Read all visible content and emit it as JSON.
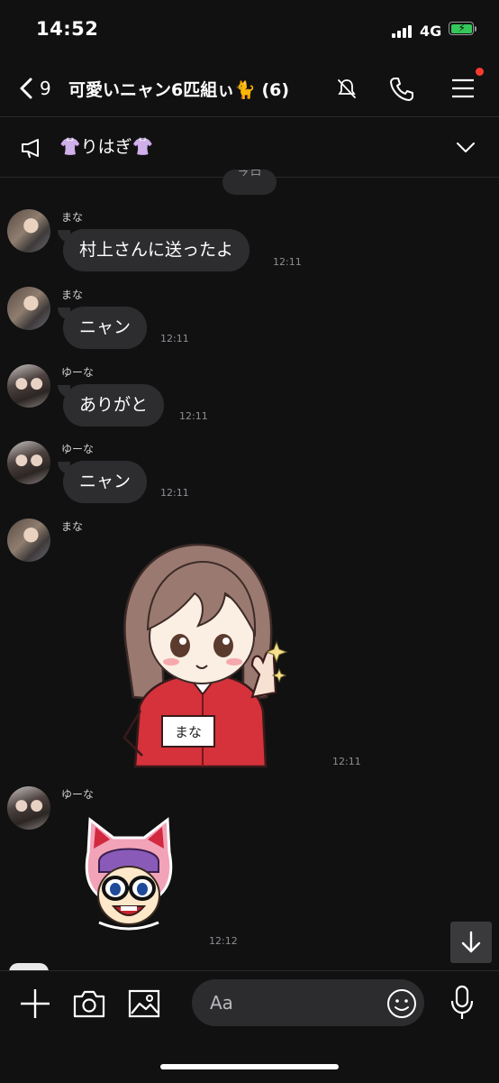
{
  "status_bar": {
    "time": "14:52",
    "network": "4G"
  },
  "header": {
    "back_count": "9",
    "title": "可愛いニャン6匹組ぃ🐈 (6)"
  },
  "announcement": {
    "text": "👚りはぎ👚"
  },
  "date_divider": "今日",
  "messages": [
    {
      "sender": "まな",
      "avatar": "mana",
      "type": "text",
      "text": "村上さんに送ったよ",
      "time": "12:11"
    },
    {
      "sender": "まな",
      "avatar": "mana",
      "type": "text",
      "text": "ニャン",
      "time": "12:11"
    },
    {
      "sender": "ゆーな",
      "avatar": "yuna",
      "type": "text",
      "text": "ありがと",
      "time": "12:11"
    },
    {
      "sender": "ゆーな",
      "avatar": "yuna",
      "type": "text",
      "text": "ニャン",
      "time": "12:11"
    },
    {
      "sender": "まな",
      "avatar": "mana",
      "type": "sticker",
      "sticker": "girl-thumbs-up-sticker",
      "sticker_label": "まな",
      "time": "12:11"
    },
    {
      "sender": "ゆーな",
      "avatar": "yuna",
      "type": "sticker",
      "sticker": "cat-hood-girl-sticker",
      "time": "12:12"
    }
  ],
  "input": {
    "placeholder": "Aa"
  },
  "icons": {
    "back": "chevron-left-icon",
    "mute": "mute-icon",
    "call": "phone-icon",
    "menu": "hamburger-menu-icon",
    "announce": "megaphone-icon",
    "expand": "chevron-down-icon",
    "scroll": "arrow-down-icon",
    "plus": "plus-icon",
    "camera": "camera-icon",
    "image": "image-icon",
    "emoji": "emoji-icon",
    "mic": "microphone-icon"
  },
  "colors": {
    "background": "#111112",
    "bubble": "#2d2d30",
    "notification_dot": "#ff3b30",
    "battery": "#34c759"
  }
}
